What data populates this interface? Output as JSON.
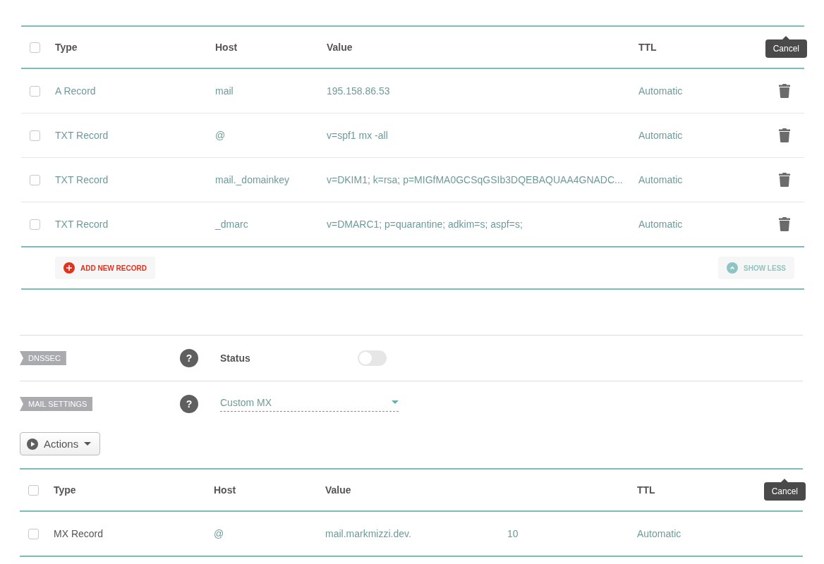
{
  "records_table": {
    "columns": {
      "type": "Type",
      "host": "Host",
      "value": "Value",
      "ttl": "TTL"
    },
    "header_checked": false,
    "tooltip": "Cancel",
    "show_delete": true,
    "rows": [
      {
        "checked": false,
        "type": "A Record",
        "host": "mail",
        "value": "195.158.86.53",
        "ttl": "Automatic"
      },
      {
        "checked": false,
        "type": "TXT Record",
        "host": "@",
        "value": "v=spf1 mx -all",
        "ttl": "Automatic"
      },
      {
        "checked": false,
        "type": "TXT Record",
        "host": "mail._domainkey",
        "value": "v=DKIM1; k=rsa; p=MIGfMA0GCSqGSIb3DQEBAQUAA4GNADC...",
        "ttl": "Automatic"
      },
      {
        "checked": false,
        "type": "TXT Record",
        "host": "_dmarc",
        "value": "v=DMARC1; p=quarantine; adkim=s; aspf=s;",
        "ttl": "Automatic"
      }
    ],
    "footer": {
      "add_button": "ADD NEW RECORD",
      "show_less_button": "SHOW LESS"
    }
  },
  "dnssec": {
    "label": "DNSSEC",
    "help": "?",
    "status_label": "Status",
    "on": false
  },
  "mail_settings": {
    "label": "MAIL SETTINGS",
    "help": "?",
    "dropdown_value": "Custom MX"
  },
  "actions_button": "Actions",
  "mx_table": {
    "columns": {
      "type": "Type",
      "host": "Host",
      "value": "Value",
      "ttl": "TTL"
    },
    "header_checked": false,
    "tooltip": "Cancel",
    "rows": [
      {
        "checked": false,
        "type": "MX Record",
        "host": "@",
        "value": "mail.markmizzi.dev.",
        "column_5": "10",
        "ttl": "Automatic"
      }
    ]
  }
}
